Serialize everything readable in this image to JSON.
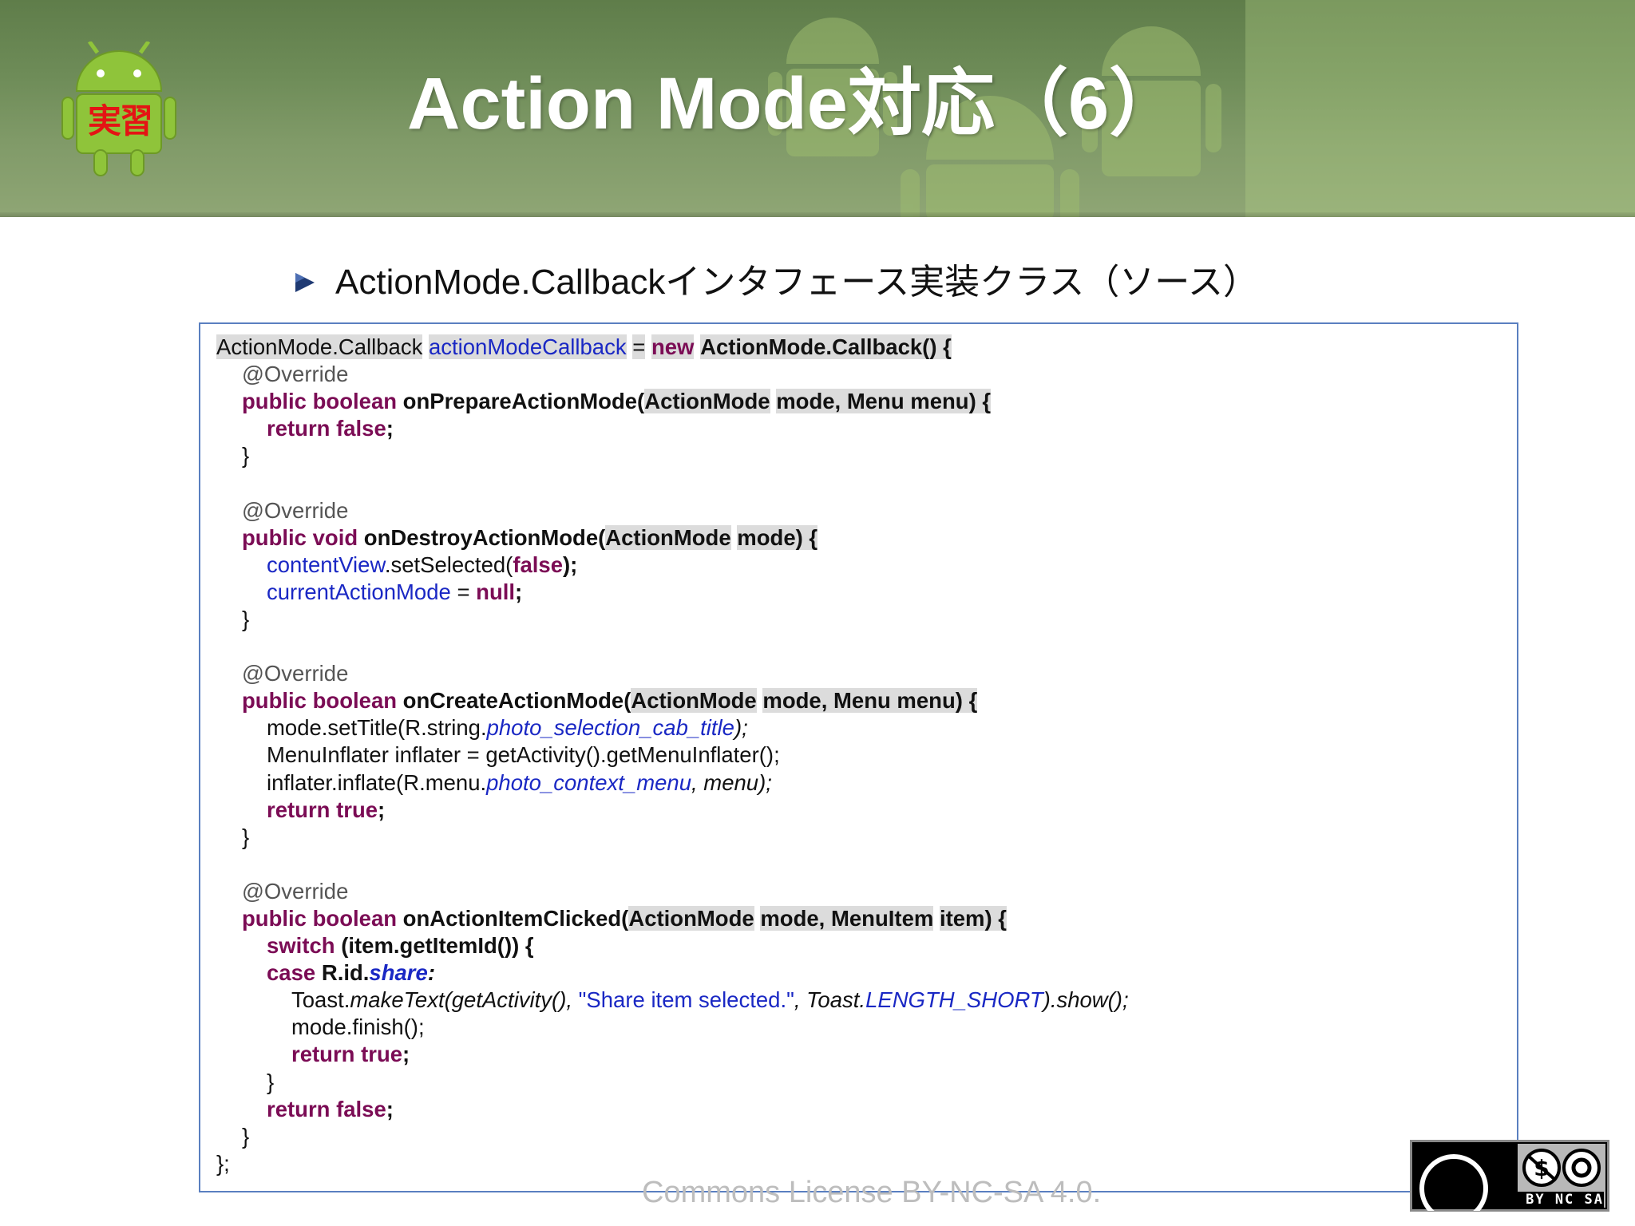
{
  "header": {
    "title": "Action Mode対応（6）",
    "logo_text": "実習"
  },
  "bullet": {
    "text": "ActionMode.Callbackインタフェース実装クラス（ソース）"
  },
  "code": {
    "l1": {
      "a": "ActionMode.Callback",
      "b": "actionModeCallback",
      "c": "=",
      "d": "new",
      "e": "ActionMode.Callback() {"
    },
    "l2": "@Override",
    "l3": {
      "a": "public boolean",
      "b": "onPrepareActionMode(",
      "c": "ActionMode",
      "d": "mode, Menu menu) {"
    },
    "l4": {
      "a": "return false",
      "b": ";"
    },
    "l5": "}",
    "l7": "@Override",
    "l8": {
      "a": "public void",
      "b": "onDestroyActionMode(",
      "c": "ActionMode",
      "d": "mode) {"
    },
    "l9": {
      "a": "contentView",
      "b": ".setSelected(",
      "c": "false",
      "d": ");"
    },
    "l10": {
      "a": "currentActionMode",
      "b": " = ",
      "c": "null",
      "d": ";"
    },
    "l11": "}",
    "l13": "@Override",
    "l14": {
      "a": "public boolean",
      "b": "onCreateActionMode(",
      "c": "ActionMode",
      "d": "mode, Menu menu) {"
    },
    "l15": {
      "a": "mode.setTitle(R.string.",
      "b": "photo_selection_cab_title",
      "c": ");"
    },
    "l16": "MenuInflater inflater = getActivity().getMenuInflater();",
    "l17": {
      "a": "inflater.inflate(R.menu.",
      "b": "photo_context_menu",
      "c": ", menu);"
    },
    "l18": {
      "a": "return true",
      "b": ";"
    },
    "l19": "}",
    "l21": "@Override",
    "l22": {
      "a": "public boolean",
      "b": "onActionItemClicked(",
      "c": "ActionMode",
      "d": "mode, MenuItem",
      "e": "item) {"
    },
    "l23": {
      "a": "switch",
      "b": " (item.getItemId()) {"
    },
    "l24": {
      "a": "case",
      "b": " R.id.",
      "c": "share",
      "d": ":"
    },
    "l25": {
      "a": "Toast.",
      "b": "makeText(getActivity(), ",
      "c": "\"Share item selected.\"",
      "d": ", Toast.",
      "e": "LENGTH_SHORT",
      "f": ").show();"
    },
    "l26": "mode.finish();",
    "l27": {
      "a": "return true",
      "b": ";"
    },
    "l28": "}",
    "l29": {
      "a": "return false",
      "b": ";"
    },
    "l30": "}",
    "l31": "};"
  },
  "footer": {
    "license_text": "Commons License BY-NC-SA 4.0.",
    "cc_label": "BY NC SA"
  },
  "colors": {
    "keyword": "#7b0c55",
    "field": "#1a28c4",
    "border": "#5a7fc0",
    "title": "#ffffff"
  }
}
